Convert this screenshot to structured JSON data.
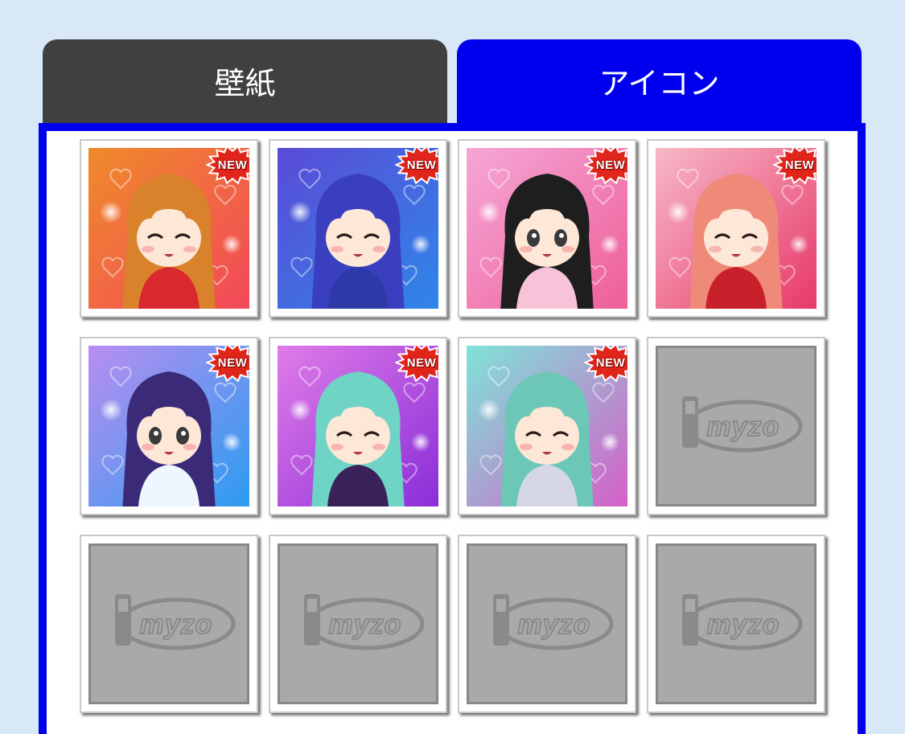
{
  "tabs": [
    {
      "label": "壁紙",
      "active": false
    },
    {
      "label": "アイコン",
      "active": true
    }
  ],
  "colors": {
    "page_bg": "#d8e8f7",
    "active_tab": "#0000ee",
    "inactive_tab": "#404040",
    "placeholder": "#a9a9a9",
    "badge": "#e0251b"
  },
  "grid": {
    "items": [
      {
        "type": "icon",
        "badge": "NEW",
        "theme": [
          "#f08a2a",
          "#f2485a"
        ],
        "hair": "#d9822b",
        "eyes": "closed",
        "accent": "#d9282e",
        "image_icon": "character-icon"
      },
      {
        "type": "icon",
        "badge": "NEW",
        "theme": [
          "#5a4bd6",
          "#2f86e8"
        ],
        "hair": "#3a3fbf",
        "eyes": "closed",
        "accent": "#2d3aa8",
        "image_icon": "character-icon"
      },
      {
        "type": "icon",
        "badge": "NEW",
        "theme": [
          "#f5a6d6",
          "#ee5f98"
        ],
        "hair": "#1e1e1e",
        "eyes": "open",
        "accent": "#f6c3d8",
        "image_icon": "character-icon"
      },
      {
        "type": "icon",
        "badge": "NEW",
        "theme": [
          "#f7b9c8",
          "#e7386a"
        ],
        "hair": "#f08a78",
        "eyes": "closed",
        "accent": "#c8202a",
        "image_icon": "character-icon"
      },
      {
        "type": "icon",
        "badge": "NEW",
        "theme": [
          "#b98ef0",
          "#2b9cf0"
        ],
        "hair": "#3b2a78",
        "eyes": "open",
        "accent": "#eef6ff",
        "image_icon": "character-icon"
      },
      {
        "type": "icon",
        "badge": "NEW",
        "theme": [
          "#e07be8",
          "#8a2ed8"
        ],
        "hair": "#6fd3c6",
        "eyes": "closed",
        "accent": "#3a2158",
        "image_icon": "character-icon"
      },
      {
        "type": "icon",
        "badge": "NEW",
        "theme": [
          "#7fe3d8",
          "#d460c8"
        ],
        "hair": "#6cc7b7",
        "eyes": "closed",
        "accent": "#d5d8e4",
        "image_icon": "character-icon"
      },
      {
        "type": "placeholder",
        "logo": "myzo",
        "image_icon": "myzo-logo-icon"
      },
      {
        "type": "placeholder",
        "logo": "myzo",
        "image_icon": "myzo-logo-icon"
      },
      {
        "type": "placeholder",
        "logo": "myzo",
        "image_icon": "myzo-logo-icon"
      },
      {
        "type": "placeholder",
        "logo": "myzo",
        "image_icon": "myzo-logo-icon"
      },
      {
        "type": "placeholder",
        "logo": "myzo",
        "image_icon": "myzo-logo-icon"
      }
    ]
  }
}
